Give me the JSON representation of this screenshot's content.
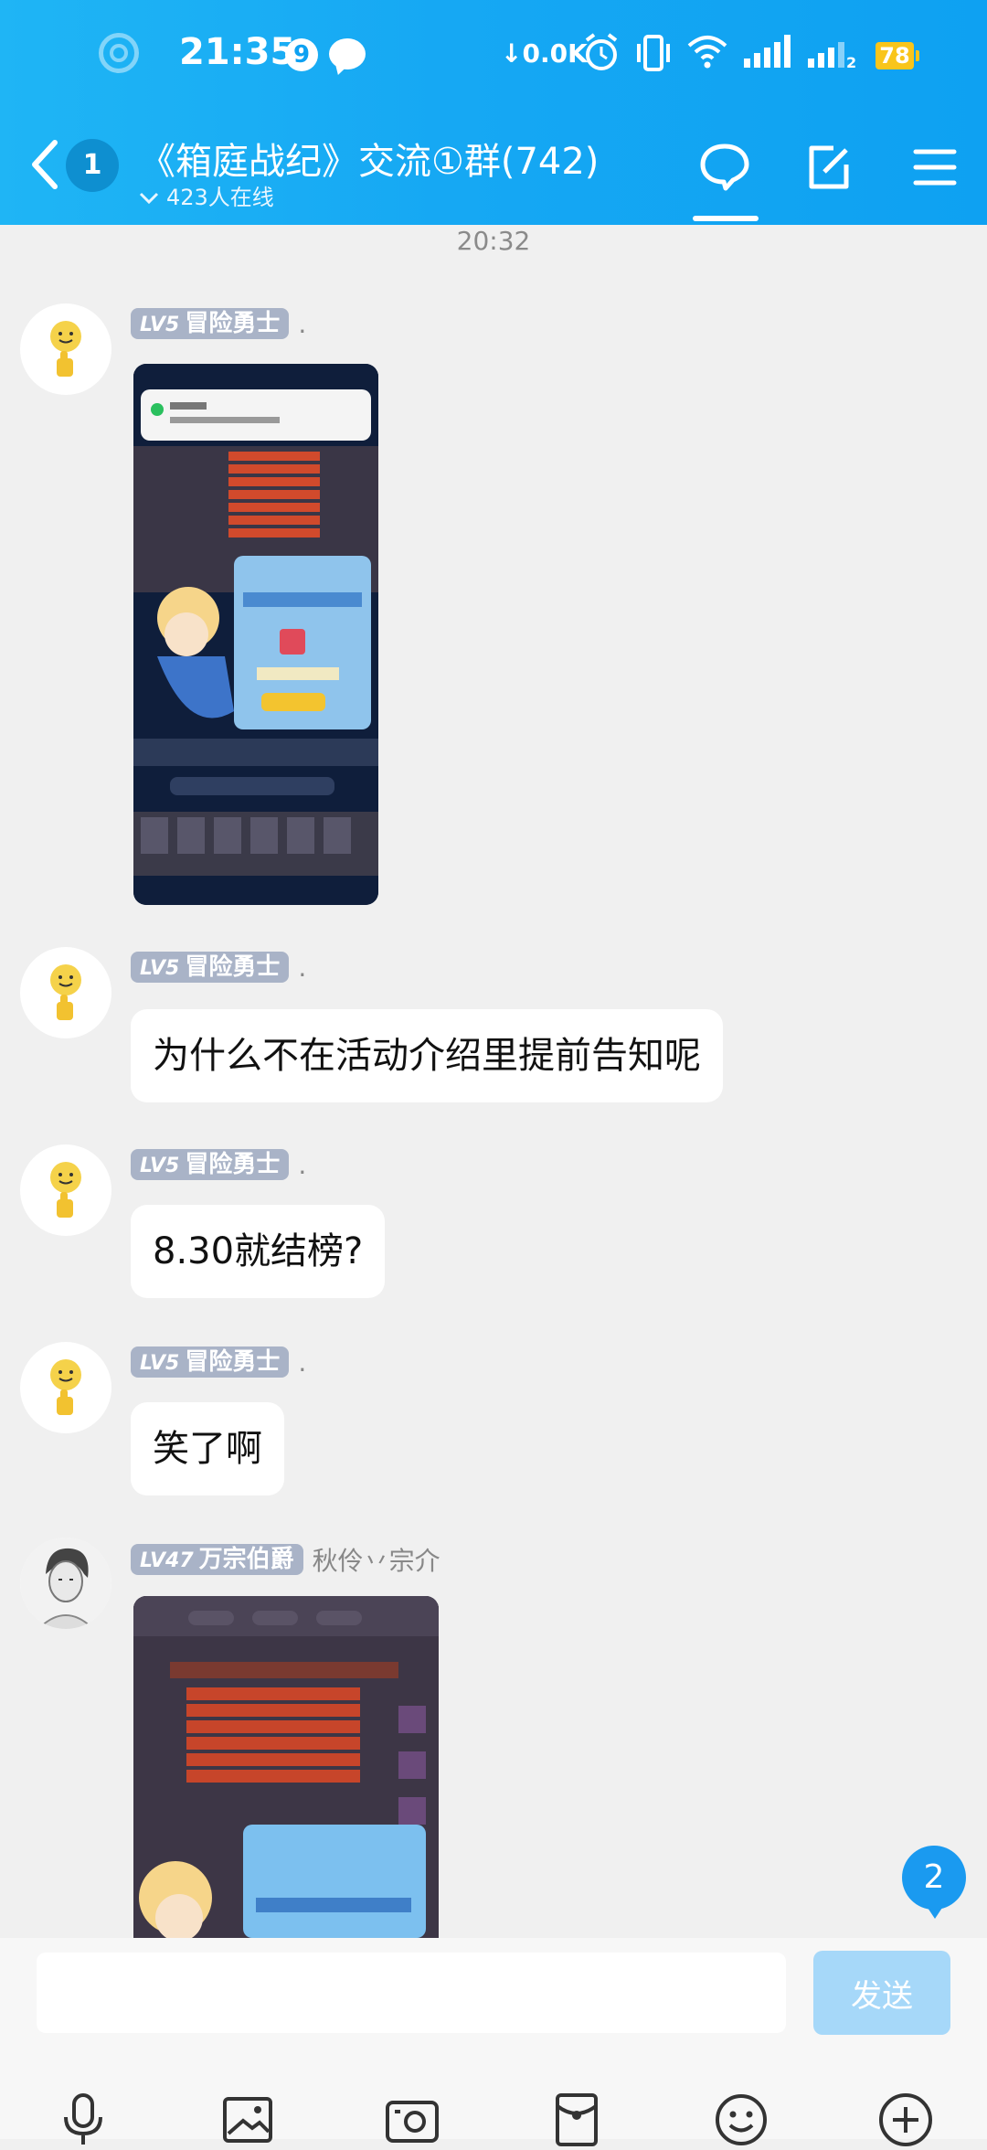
{
  "status_bar": {
    "time": "21:35",
    "notif_count": "9",
    "net_speed": "0.0K",
    "battery": "78"
  },
  "header": {
    "back_unread": "1",
    "title": "《箱庭战纪》交流①群(742)",
    "online": "423人在线"
  },
  "chat": {
    "timestamp": "20:32",
    "messages": [
      {
        "level": "LV5",
        "name": "冒险勇士",
        "note": ".",
        "type": "image"
      },
      {
        "level": "LV5",
        "name": "冒险勇士",
        "note": ".",
        "text": "为什么不在活动介绍里提前告知呢"
      },
      {
        "level": "LV5",
        "name": "冒险勇士",
        "note": ".",
        "text": "8.30就结榜?"
      },
      {
        "level": "LV5",
        "name": "冒险勇士",
        "note": ".",
        "text": "笑了啊"
      },
      {
        "level": "LV47",
        "name": "万宗伯爵",
        "note": "秋伶丷宗介",
        "type": "image"
      }
    ]
  },
  "floating_unread": "2",
  "input": {
    "placeholder": "",
    "send_label": "发送"
  },
  "colors": {
    "header": "#16a8f3",
    "badge": "#a9b3c7",
    "send_disabled": "#a6d8f9"
  }
}
